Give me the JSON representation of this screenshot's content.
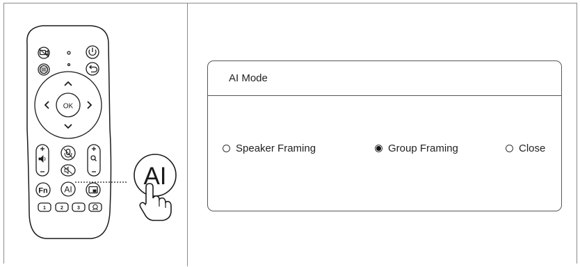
{
  "remote": {
    "ok_label": "OK",
    "fn_label": "Fn",
    "ai_label": "AI",
    "ai_callout_label": "AI",
    "preset_labels": [
      "1",
      "2",
      "3"
    ]
  },
  "dialog": {
    "title": "AI Mode",
    "options": [
      {
        "label": "Speaker Framing",
        "selected": false
      },
      {
        "label": "Group Framing",
        "selected": true
      },
      {
        "label": "Close",
        "selected": false
      }
    ]
  }
}
